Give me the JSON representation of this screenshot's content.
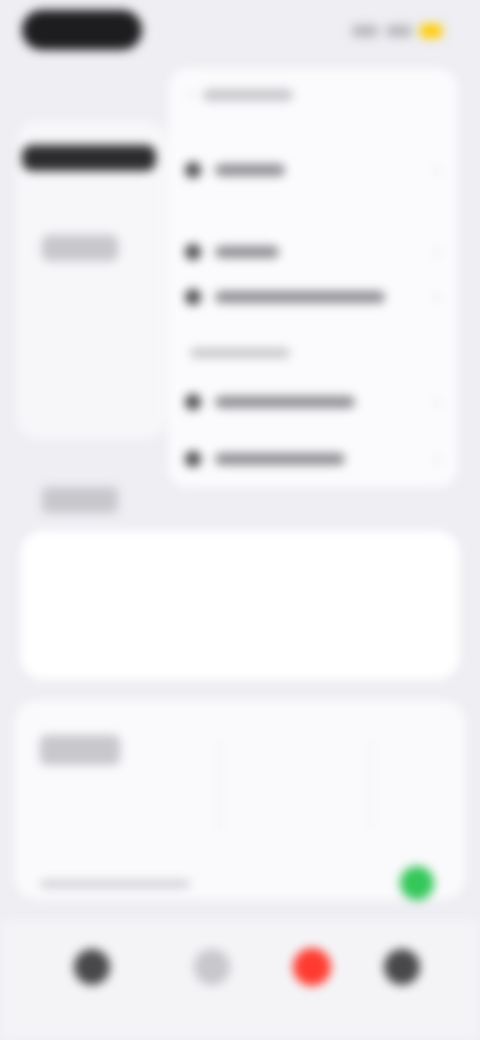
{
  "status_bar": {
    "time_pill": "",
    "indicators": [
      "signal-icon",
      "wifi-icon",
      "battery-icon"
    ]
  },
  "menu": {
    "header_label": "",
    "items": [
      {
        "icon": "circle-icon",
        "label": ""
      },
      {
        "icon": "circle-icon",
        "label": ""
      },
      {
        "icon": "circle-icon",
        "label": ""
      }
    ],
    "section_label": "",
    "section_items": [
      {
        "icon": "circle-icon",
        "label": ""
      },
      {
        "icon": "circle-icon",
        "label": ""
      }
    ]
  },
  "left_panel": {
    "title": "",
    "subtitle": "",
    "second_title": "",
    "third_title": ""
  },
  "bottom_stats": {
    "col1": "",
    "col2": "",
    "col3": "",
    "footer_note": ""
  },
  "tab_bar": {
    "tabs": [
      {
        "icon": "home-icon",
        "label": ""
      },
      {
        "icon": "profile-icon",
        "label": ""
      },
      {
        "icon": "record-icon",
        "label": ""
      },
      {
        "icon": "settings-icon",
        "label": ""
      }
    ]
  },
  "colors": {
    "accent_red": "#ff3b30",
    "accent_green": "#34c759",
    "accent_yellow": "#ffcc00",
    "background": "#eeeef3"
  }
}
